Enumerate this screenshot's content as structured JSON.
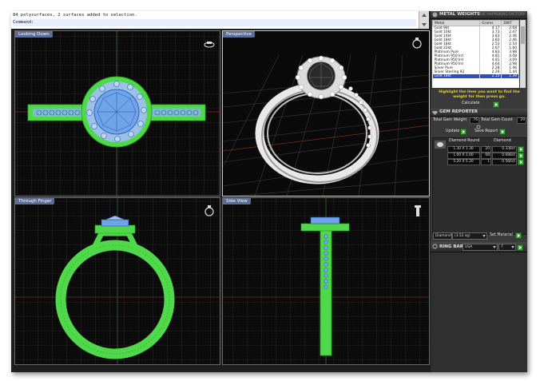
{
  "command": {
    "line1": "84 polysurfaces, 2 surfaces added to selection.",
    "line2": "Command:"
  },
  "viewports": [
    {
      "label": "Looking Down"
    },
    {
      "label": "Perspective"
    },
    {
      "label": "Through Finger"
    },
    {
      "label": "Side View"
    }
  ],
  "metal_weights": {
    "title": "METAL WEIGHTS",
    "subtitle": "THE HAPPENING FACTORY",
    "columns": [
      "Metal",
      "Grams",
      "DWT"
    ],
    "rows": [
      [
        "Gold 9kt",
        "4.17",
        "2.68"
      ],
      [
        "Gold 10kt",
        "3.73",
        "2.47"
      ],
      [
        "Gold 14kt",
        "3.83",
        "2.46"
      ],
      [
        "Gold 18kt",
        "3.83",
        "2.46"
      ],
      [
        "Gold 18kt",
        "2.53",
        "2.54"
      ],
      [
        "Gold 22kt",
        "2.67",
        "1.60"
      ],
      [
        "Platinum Pure",
        "4.83",
        "3.98"
      ],
      [
        "Platinum 950 Ird",
        "4.81",
        "4.08"
      ],
      [
        "Platinum 950 Ird",
        "4.81",
        "3.09"
      ],
      [
        "Platinum 950 Ird",
        "4.64",
        "2.98"
      ],
      [
        "Silver Pure",
        "2.28",
        "1.46"
      ],
      [
        "Silver Sterling 92",
        "2.26",
        "1.44"
      ]
    ],
    "selected_row": 12,
    "extra_row": [
      "Gold 18kt",
      "2.15",
      "1.39"
    ],
    "hint": "Highlight the item you want to find the weight for then press go.",
    "calculate_label": "Calculate"
  },
  "gem_reporter": {
    "title": "GEM REPORTER",
    "total_weight_label": "Total Gem Weight",
    "total_weight_value": ".76",
    "total_count_label": "Total Gem Count",
    "total_count_value": "29",
    "update_label": "Update",
    "save_label": "Save Report",
    "columns": [
      "Diamond Round",
      "Diamond"
    ],
    "rows": [
      [
        "1.30 X 1.30",
        "20",
        "0.338ct"
      ],
      [
        "1.00 X 1.00",
        "08",
        "0.088ct"
      ],
      [
        "5.20 X 5.20",
        "1",
        "0.566ct"
      ]
    ]
  },
  "material": {
    "selected": "Diamond",
    "option": "(3.52 sg)",
    "set_label": "Set Material"
  },
  "ring_bar": {
    "label": "RING BAR",
    "region": "USA",
    "size": "7"
  },
  "colors": {
    "viewport_bg": "#0a0a0a",
    "wire_green": "#58e04f",
    "gem_blue": "#6fa5e8",
    "panel_bg": "#3a3a3a",
    "label_blue": "#5b6d96"
  }
}
